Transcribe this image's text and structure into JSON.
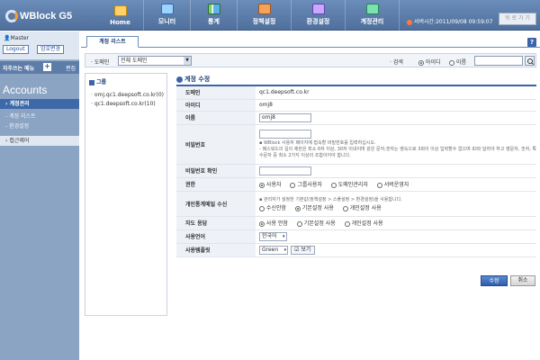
{
  "header": {
    "logo": "WBlock G5",
    "nav": [
      "Home",
      "모니터",
      "통계",
      "정책설정",
      "환경설정",
      "계정관리"
    ],
    "server_time": "서버시간:2011/09/08 09:59:07",
    "back_label": "뒤 로 가 기"
  },
  "sidebar": {
    "user": "Master",
    "logout": "Logout",
    "password_change": "암호변경",
    "favorites_label": "자주쓰는 메뉴",
    "favorites_edit": "편집",
    "section_title": "Accounts",
    "items": [
      {
        "label": "계정관리"
      },
      {
        "label": "계정 리스트"
      },
      {
        "label": "환경설정"
      },
      {
        "label": "접근제어"
      }
    ]
  },
  "main": {
    "tab": "계정 리스트",
    "filter": {
      "domain_label": "도메인",
      "domain_value": "전체 도메인",
      "search_label": "검색",
      "opt_id": "아이디",
      "opt_name": "이름",
      "search_value": ""
    },
    "groups": {
      "title": "그룹",
      "items": [
        "omj.qc1.deepsoft.co.kr(0)",
        "qc1.deepsoft.co.kr(10)"
      ]
    },
    "form": {
      "title": "계정 수정",
      "domain_label": "도메인",
      "domain_value": "qc1.deepsoft.co.kr",
      "id_label": "아이디",
      "id_value": "omj8",
      "name_label": "이름",
      "name_value": "omj8",
      "pw_label": "비밀번호",
      "pw_note1": "WBlock 사용자 페이지에 접속할 비밀번호를 입력하십시오.",
      "pw_note2": "- 패스워드의 길이 제한은 최소 6자 이상, 30자 이내이며 같은 문자,숫자는 영속으로 3회이 이상 입력할수 없으며 ID와 달라야 하고 영문자, 숫자, 특수문자 중 최소 2가지 이상의 조합이어야 합니다.",
      "pw_confirm_label": "비밀번호 확인",
      "perm_label": "권한",
      "perm_opts": [
        "사용자",
        "그룹사용자",
        "도메인관리자",
        "서버운영자"
      ],
      "mail_label": "개인통계메일 수신",
      "mail_note": "관리자가 설정한 기본값(정책설정 > 스풀설정 > 환경설정)을 사용합니다.",
      "mail_opts": [
        "수신안함",
        "기본설정 사용",
        "개인설정 사용"
      ],
      "auto_label": "자도 응답",
      "auto_opts": [
        "사용 안함",
        "기본설정 사용",
        "개인설정 사용"
      ],
      "lang_label": "사용언어",
      "lang_value": "한국어",
      "template_label": "사용템플릿",
      "template_value": "Green",
      "view_label": "보기",
      "save": "수정",
      "cancel": "취소"
    }
  }
}
